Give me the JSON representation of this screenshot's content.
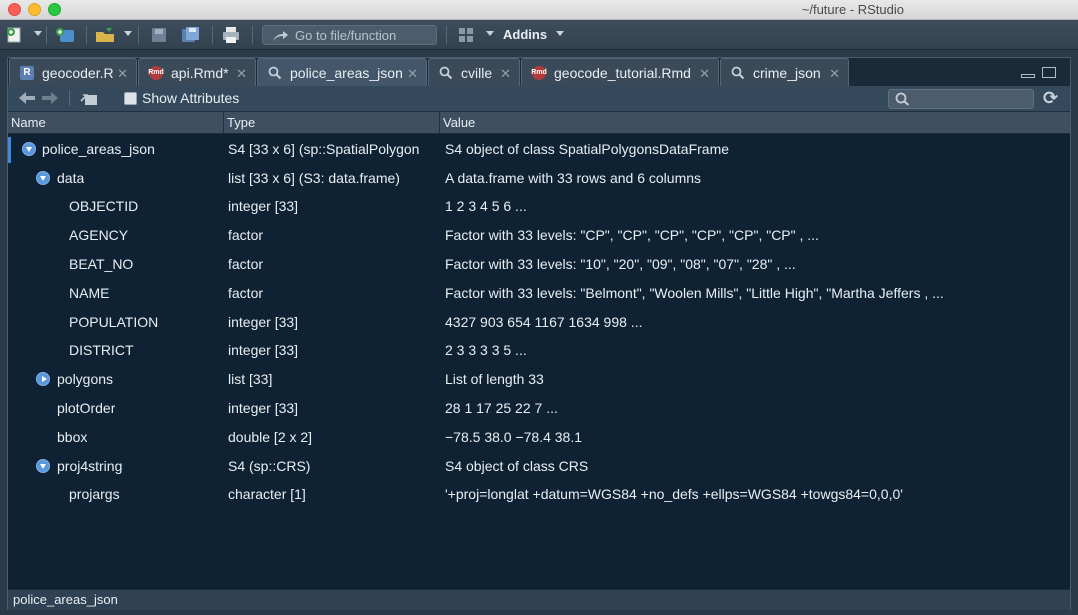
{
  "window": {
    "title": "~/future - RStudio"
  },
  "toolbar": {
    "goto_placeholder": "Go to file/function",
    "addins_label": "Addins"
  },
  "tabs": [
    {
      "label": "geocoder.R",
      "icon": "r-file-icon"
    },
    {
      "label": "api.Rmd*",
      "icon": "rmd-file-icon"
    },
    {
      "label": "police_areas_json",
      "icon": "magnifier-icon",
      "active": true
    },
    {
      "label": "cville",
      "icon": "magnifier-icon"
    },
    {
      "label": "geocode_tutorial.Rmd",
      "icon": "rmd-file-icon"
    },
    {
      "label": "crime_json",
      "icon": "magnifier-icon"
    }
  ],
  "viewer": {
    "show_attributes_label": "Show Attributes",
    "columns": {
      "name": "Name",
      "type": "Type",
      "value": "Value"
    },
    "rows": [
      {
        "name": "police_areas_json",
        "type": "S4 [33 x 6] (sp::SpatialPolygon",
        "value": "S4 object of class SpatialPolygonsDataFrame",
        "expander": "down"
      },
      {
        "name": "data",
        "type": "list [33 x 6] (S3: data.frame)",
        "value": "A data.frame with 33 rows and 6 columns",
        "expander": "down"
      },
      {
        "name": "OBJECTID",
        "type": "integer [33]",
        "value": "1 2 3 4 5 6 ..."
      },
      {
        "name": "AGENCY",
        "type": "factor",
        "value": "Factor with 33 levels: \"CP\", \"CP\", \"CP\", \"CP\", \"CP\", \"CP\" , ..."
      },
      {
        "name": "BEAT_NO",
        "type": "factor",
        "value": "Factor with 33 levels: \"10\", \"20\", \"09\", \"08\", \"07\", \"28\" , ..."
      },
      {
        "name": "NAME",
        "type": "factor",
        "value": "Factor with 33 levels: \"Belmont\", \"Woolen Mills\", \"Little High\", \"Martha Jeffers , ..."
      },
      {
        "name": "POPULATION",
        "type": "integer [33]",
        "value": "4327 903 654 1167 1634 998 ..."
      },
      {
        "name": "DISTRICT",
        "type": "integer [33]",
        "value": "2 3 3 3 3 5 ..."
      },
      {
        "name": "polygons",
        "type": "list [33]",
        "value": "List of length 33",
        "expander": "right"
      },
      {
        "name": "plotOrder",
        "type": "integer [33]",
        "value": "28 1 17 25 22 7 ..."
      },
      {
        "name": "bbox",
        "type": "double [2 x 2]",
        "value": "−78.5 38.0 −78.4 38.1"
      },
      {
        "name": "proj4string",
        "type": "S4 (sp::CRS)",
        "value": "S4 object of class CRS",
        "expander": "down"
      },
      {
        "name": "projargs",
        "type": "character [1]",
        "value": "'+proj=longlat +datum=WGS84 +no_defs +ellps=WGS84 +towgs84=0,0,0'"
      }
    ]
  },
  "status": {
    "text": "police_areas_json"
  },
  "colors": {
    "accent": "#3f8ae0",
    "background": "#0f2234"
  }
}
